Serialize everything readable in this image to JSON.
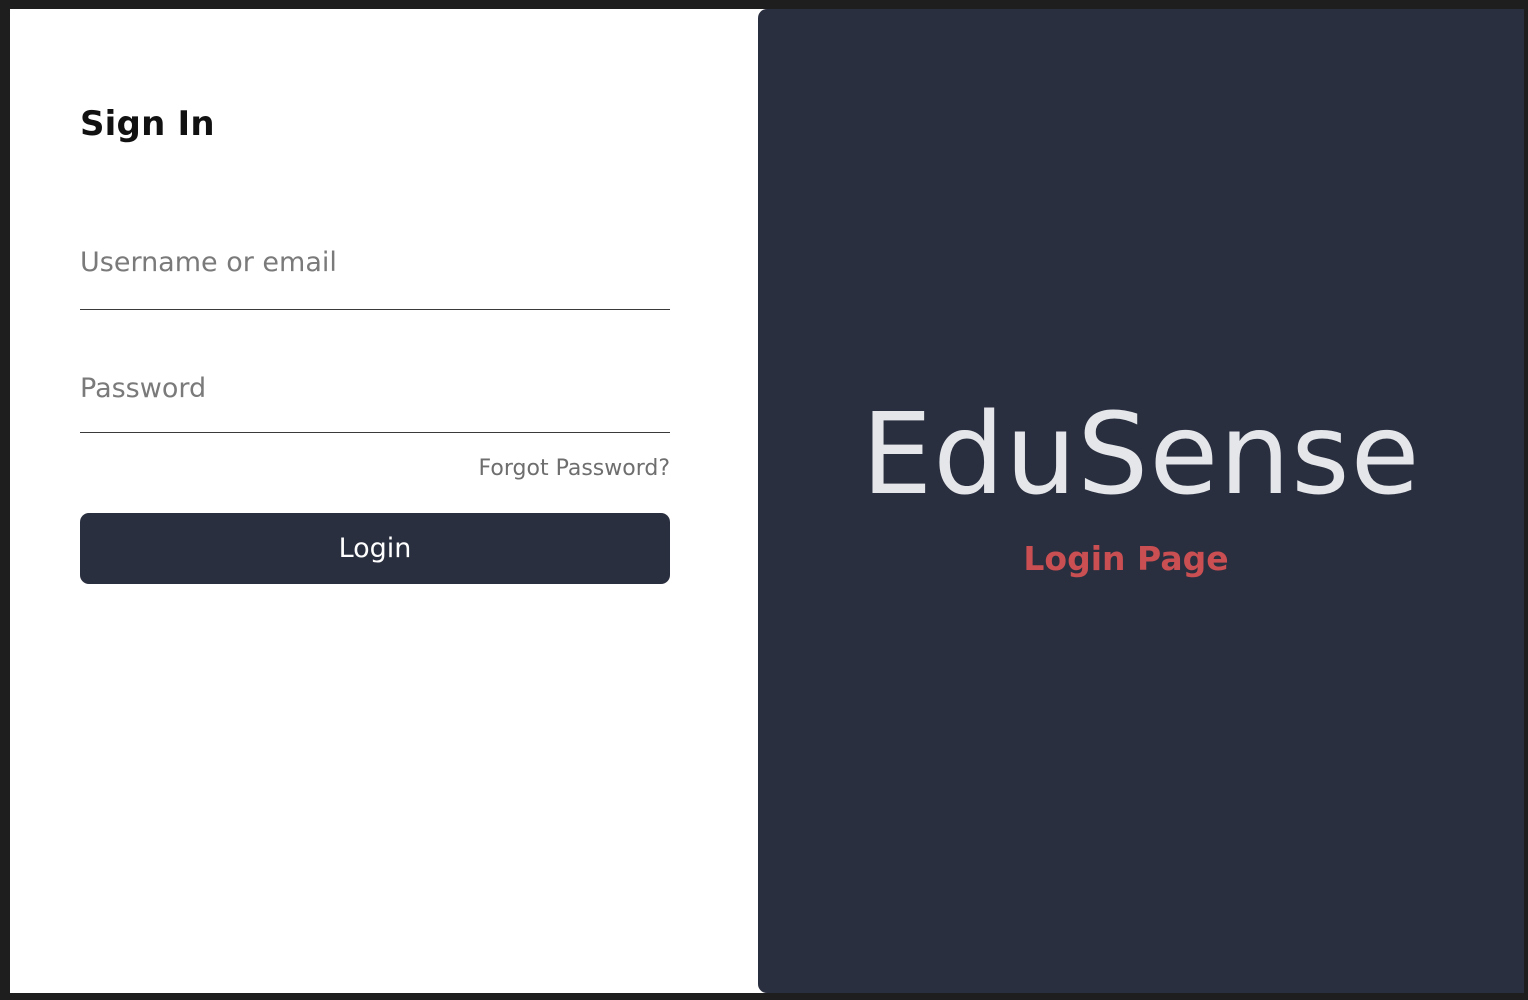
{
  "sign_in": {
    "title": "Sign In",
    "username": {
      "value": "",
      "placeholder": "Username or email"
    },
    "password": {
      "value": "",
      "placeholder": "Password"
    },
    "forgot_password_label": "Forgot Password?",
    "login_label": "Login"
  },
  "brand": {
    "title": "EduSense",
    "subtitle": "Login Page"
  },
  "colors": {
    "panel_dark": "#2a2f3f",
    "accent_red": "#c94f52",
    "brand_text": "#e4e6ea"
  }
}
